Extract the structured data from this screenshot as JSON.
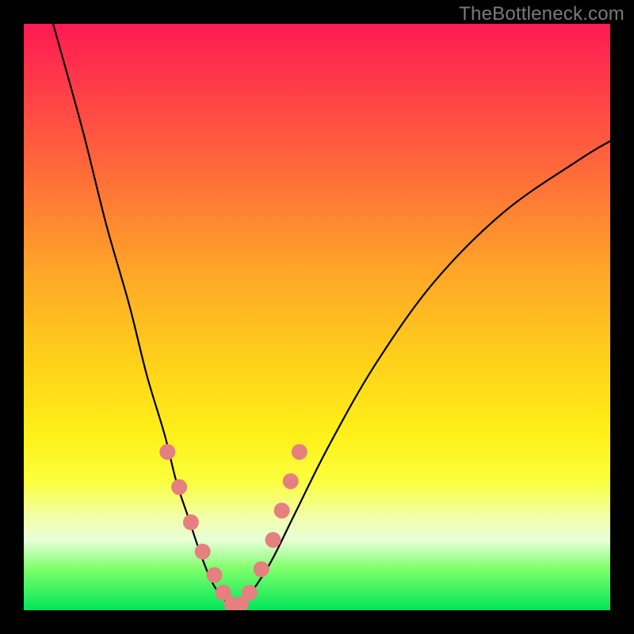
{
  "watermark": "TheBottleneck.com",
  "chart_data": {
    "type": "line",
    "title": "",
    "xlabel": "",
    "ylabel": "",
    "xlim": [
      0,
      100
    ],
    "ylim": [
      0,
      100
    ],
    "series": [
      {
        "name": "bottleneck-curve",
        "x": [
          5,
          10,
          14,
          18,
          21,
          24,
          26,
          28,
          30,
          32,
          34,
          36,
          38,
          42,
          46,
          52,
          60,
          70,
          82,
          95,
          100
        ],
        "y": [
          100,
          82,
          66,
          52,
          40,
          30,
          22,
          16,
          10,
          5,
          2,
          0.5,
          2,
          8,
          16,
          28,
          42,
          56,
          68,
          77,
          80
        ]
      }
    ],
    "markers": {
      "name": "fit-dots",
      "color": "#e67f7f",
      "x": [
        24.5,
        26.5,
        28.5,
        30.5,
        32.5,
        34.0,
        35.5,
        37.0,
        38.5,
        40.5,
        42.5,
        44.0,
        45.5,
        47.0
      ],
      "y": [
        27,
        21,
        15,
        10,
        6,
        3,
        1,
        1,
        3,
        7,
        12,
        17,
        22,
        27
      ]
    },
    "background_gradient": {
      "top": "#ff1a52",
      "bottom": "#00e65a"
    }
  }
}
